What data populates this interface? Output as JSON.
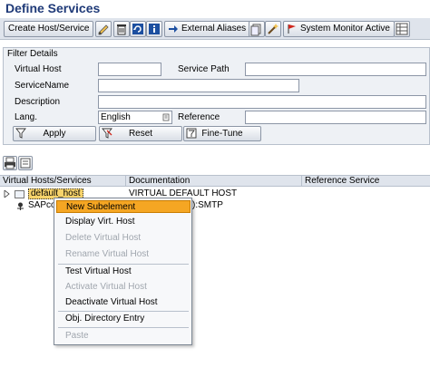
{
  "page_title": "Define Services",
  "toolbar": {
    "create_label": "Create Host/Service",
    "external_aliases_label": "External Aliases",
    "system_monitor_label": "System Monitor Active"
  },
  "filter": {
    "title": "Filter Details",
    "virtual_host_label": "Virtual Host",
    "virtual_host_value": "",
    "service_path_label": "Service Path",
    "service_path_value": "",
    "service_name_label": "ServiceName",
    "service_name_value": "",
    "description_label": "Description",
    "description_value": "",
    "lang_label": "Lang.",
    "lang_value": "English",
    "reference_label": "Reference",
    "reference_value": "",
    "apply_label": "Apply",
    "reset_label": "Reset",
    "finetune_label": "Fine-Tune"
  },
  "tree": {
    "columns": [
      "Virtual Hosts/Services",
      "Documentation",
      "Reference Service"
    ],
    "rows": [
      {
        "name": "default_host",
        "doc": "VIRTUAL DEFAULT HOST",
        "ref": ""
      },
      {
        "name": "SAPco",
        "doc": "):SMTP",
        "ref": ""
      }
    ]
  },
  "context_menu": {
    "items": [
      {
        "label": "New Subelement",
        "state": "active"
      },
      {
        "label": "Display Virt. Host",
        "state": "enabled"
      },
      {
        "label": "Delete Virtual Host",
        "state": "disabled"
      },
      {
        "label": "Rename Virtual Host",
        "state": "disabled"
      },
      {
        "label": "Test Virtual Host",
        "state": "enabled"
      },
      {
        "label": "Activate Virtual Host",
        "state": "disabled"
      },
      {
        "label": "Deactivate Virtual Host",
        "state": "enabled"
      },
      {
        "label": "Obj. Directory Entry",
        "state": "enabled"
      },
      {
        "label": "Paste",
        "state": "disabled"
      }
    ]
  },
  "colors": {
    "title": "#1f3a78",
    "menu_highlight": "#f5a623",
    "toolbar_bg": "#dfe4ec"
  }
}
